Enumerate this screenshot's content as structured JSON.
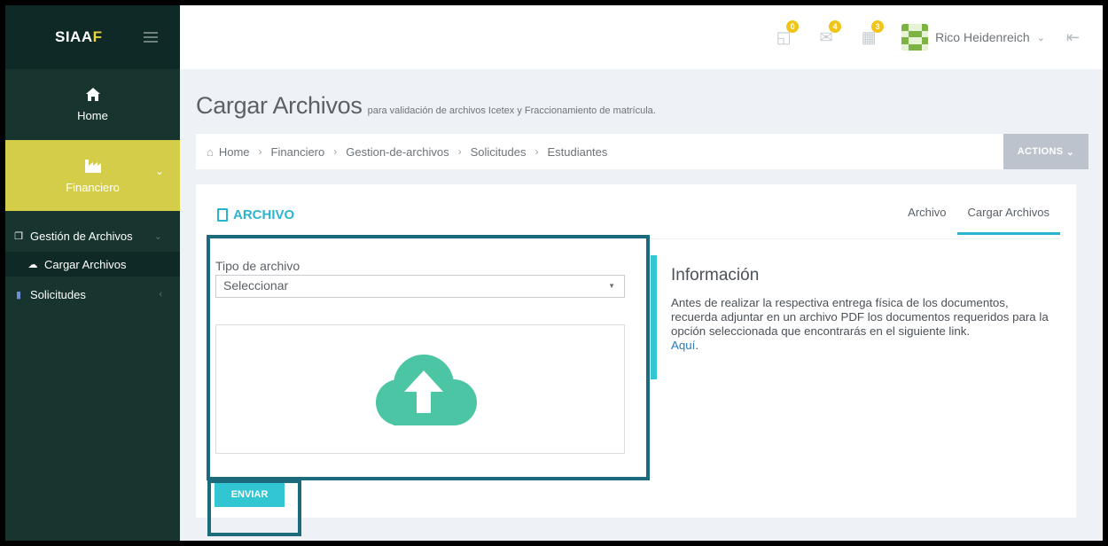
{
  "brand": {
    "name_main": "SIAA",
    "name_accent": "F"
  },
  "sidebar": {
    "home_label": "Home",
    "financiero_label": "Financiero",
    "items": [
      {
        "label": "Gestión de Archivos"
      },
      {
        "label": "Cargar Archivos"
      },
      {
        "label": "Solicitudes"
      }
    ]
  },
  "topbar": {
    "notifications_count": "0",
    "messages_count": "4",
    "calendar_count": "3",
    "user_name": "Rico Heidenreich"
  },
  "page": {
    "title": "Cargar Archivos",
    "subtitle": "para validación de archivos Icetex y Fraccionamiento de matrícula."
  },
  "breadcrumb": {
    "items": [
      "Home",
      "Financiero",
      "Gestion-de-archivos",
      "Solicitudes",
      "Estudiantes"
    ],
    "actions_label": "ACTIONS"
  },
  "portlet": {
    "title": "ARCHIVO",
    "tabs": [
      "Archivo",
      "Cargar Archivos"
    ],
    "active_tab": "Cargar Archivos"
  },
  "form": {
    "file_type_label": "Tipo de archivo",
    "file_type_value": "Seleccionar",
    "submit_label": "ENVIAR"
  },
  "info": {
    "title": "Información",
    "text": "Antes de realizar la respectiva entrega física de los documentos, recuerda adjuntar en un archivo PDF los documentos requeridos para la opción seleccionada que encontrarás en el siguiente link.",
    "link_label": "Aquí"
  },
  "colors": {
    "sidebar_bg": "#17342f",
    "active_menu": "#d4cd4a",
    "accent": "#32c5d2",
    "upload_icon": "#4cc5a5",
    "highlight_box": "#1b6b7d"
  }
}
